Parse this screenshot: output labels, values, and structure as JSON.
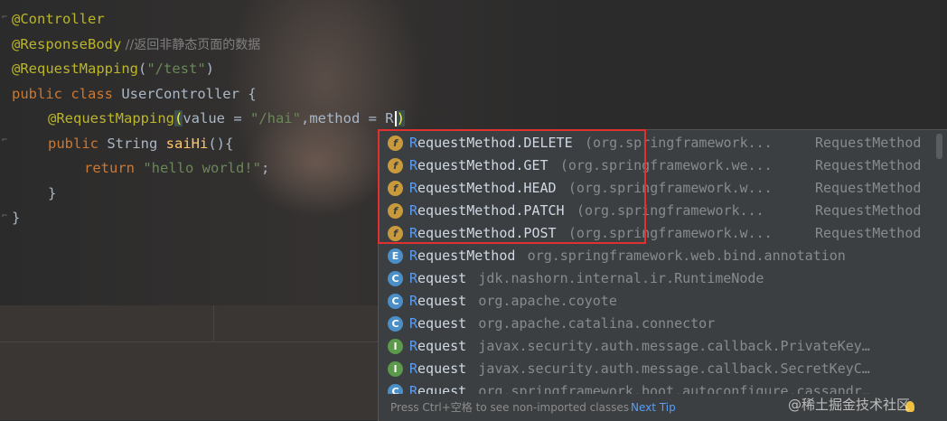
{
  "code": {
    "line1": "@Controller",
    "line2_ann": "@ResponseBody",
    "line2_cmt": " //返回非静态页面的数据",
    "line3_ann": "@RequestMapping",
    "line3_rest_a": "(",
    "line3_str": "\"/test\"",
    "line3_rest_b": ")",
    "line4_kw": "public class ",
    "line4_name": "UserController",
    "line4_rest": " {",
    "line5_ann": "@RequestMapping",
    "line5_paren": "(",
    "line5_a": "value = ",
    "line5_str": "\"/hai\"",
    "line5_b": ",method = R",
    "line5_close": ")",
    "line6_kw": "public ",
    "line6_type": "String ",
    "line6_fn": "saiHi",
    "line6_rest": "(){",
    "line7_kw": "return ",
    "line7_str": "\"hello world!\"",
    "line7_rest": ";",
    "line8": "}",
    "line9": "}"
  },
  "completion": {
    "items": [
      {
        "icon": "f",
        "match": "R",
        "rest": "equestMethod.DELETE",
        "pkg": "(org.springframework...",
        "type": "RequestMethod"
      },
      {
        "icon": "f",
        "match": "R",
        "rest": "equestMethod.GET",
        "pkg": "(org.springframework.we...",
        "type": "RequestMethod"
      },
      {
        "icon": "f",
        "match": "R",
        "rest": "equestMethod.HEAD",
        "pkg": "(org.springframework.w...",
        "type": "RequestMethod"
      },
      {
        "icon": "f",
        "match": "R",
        "rest": "equestMethod.PATCH",
        "pkg": "(org.springframework...",
        "type": "RequestMethod"
      },
      {
        "icon": "f",
        "match": "R",
        "rest": "equestMethod.POST",
        "pkg": "(org.springframework.w...",
        "type": "RequestMethod"
      },
      {
        "icon": "E",
        "match": "R",
        "rest": "equestMethod",
        "pkg": "org.springframework.web.bind.annotation",
        "type": ""
      },
      {
        "icon": "C",
        "match": "R",
        "rest": "equest",
        "pkg": "jdk.nashorn.internal.ir.RuntimeNode",
        "type": ""
      },
      {
        "icon": "C",
        "match": "R",
        "rest": "equest",
        "pkg": "org.apache.coyote",
        "type": ""
      },
      {
        "icon": "C",
        "match": "R",
        "rest": "equest",
        "pkg": "org.apache.catalina.connector",
        "type": ""
      },
      {
        "icon": "I",
        "match": "R",
        "rest": "equest",
        "pkg": "javax.security.auth.message.callback.PrivateKey…",
        "type": ""
      },
      {
        "icon": "I",
        "match": "R",
        "rest": "equest",
        "pkg": "javax.security.auth.message.callback.SecretKeyC…",
        "type": ""
      },
      {
        "icon": "C",
        "match": "R",
        "rest": "equest",
        "pkg": "org.springframework.boot.autoconfigure.cassandr…",
        "type": ""
      }
    ],
    "hint": "Press Ctrl+空格 to see non-imported classes",
    "next_tip": "Next Tip"
  },
  "watermark": "@稀土掘金技术社区",
  "colors": {
    "annotation": "#bbb529",
    "string": "#6a8759",
    "keyword": "#cc7832",
    "function": "#ffc66d",
    "match_highlight": "#589df6",
    "red_box": "#e03131"
  }
}
